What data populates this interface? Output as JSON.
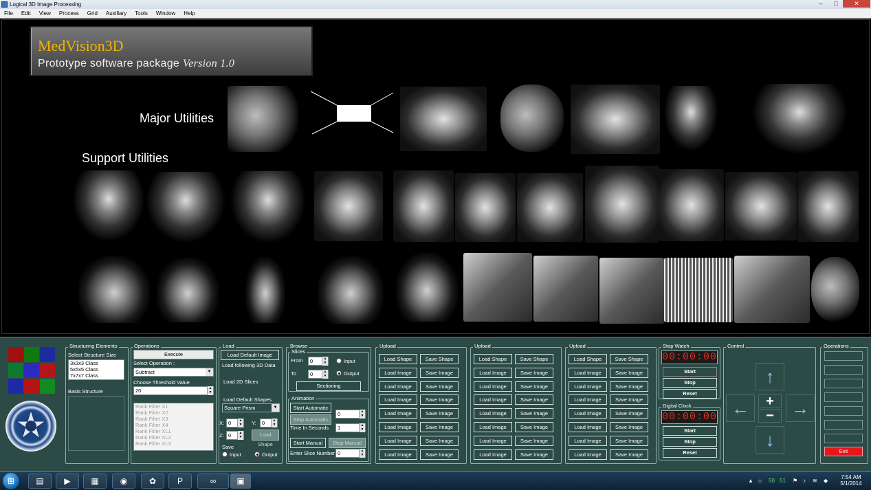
{
  "window": {
    "title": "Logical 3D Image Processing",
    "controls": {
      "minimize": "–",
      "maximize": "□",
      "close": "✕"
    }
  },
  "menu": [
    "File",
    "Edit",
    "View",
    "Process",
    "Grid",
    "Auxillary",
    "Tools",
    "Window",
    "Help"
  ],
  "brand": {
    "title": "MedVision3D",
    "subtitle": "Prototype software package",
    "version": "Version 1.0"
  },
  "headings": {
    "major": "Major Utilities",
    "support": "Support Utilities"
  },
  "structuring": {
    "group_label": "Structuring Elements",
    "size_label": "Select Structure Size",
    "sizes": [
      "3x3x3 Class",
      "5x5x5 Class",
      "7x7x7 Class"
    ],
    "basis_label": "Basis Structure"
  },
  "operations": {
    "group_label": "Operations",
    "execute": "Execute",
    "select_label": "Select Operation :",
    "selected": "Subtract",
    "threshold_label": "Choose Threshold Value",
    "threshold": "20",
    "filters": [
      "Rank Filter X1",
      "Rank Filter X2",
      "Rank Filter X3",
      "Rank Filter X4",
      "Rank Filter XL1",
      "Rank Filter XL2",
      "Rank Filter XL3"
    ]
  },
  "load": {
    "group_label": "Load",
    "default_image": "Load Default Image",
    "following": "Load following 3D Data",
    "slices": "Load 2D Slices",
    "shapes_label": "Load Default Shapes",
    "shape": "Square Prism",
    "x_label": "X:",
    "x_val": "0",
    "y_label": "Y:",
    "y_val": "0",
    "z_label": "Z:",
    "z_val": "0",
    "load_shape": "Load Shape",
    "save_label": "Save",
    "input": "Input",
    "output": "Output"
  },
  "browse": {
    "group_label": "Browse",
    "slices_label": "Slices",
    "from_label": "From",
    "from_val": "0",
    "to_label": "To",
    "to_val": "0",
    "input": "Input",
    "output": "Output",
    "sectioning": "Sectioning",
    "animation_label": "Animation",
    "start_auto": "Start Automatic",
    "stop_auto": "Stop Automatic",
    "auto_val": "0",
    "time_label": "Time In Seconds",
    "time_val": "1",
    "start_manual": "Start Manual",
    "stop_manual": "Stop Manual",
    "slice_label": "Enter Slice Number",
    "slice_val": "0"
  },
  "upload_groups": [
    {
      "label": "Upload",
      "rows": [
        [
          "Load Shape",
          "Save Shape"
        ],
        [
          "Load Image",
          "Save Image"
        ],
        [
          "Load Image",
          "Save Image"
        ],
        [
          "Load Image",
          "Save Image"
        ],
        [
          "Load Image",
          "Save Image"
        ],
        [
          "Load Image",
          "Save Image"
        ],
        [
          "Load Image",
          "Save Image"
        ],
        [
          "Load Image",
          "Save Image"
        ]
      ]
    },
    {
      "label": "Upload",
      "rows": [
        [
          "Load Shape",
          "Save Shape"
        ],
        [
          "Load Image",
          "Save Image"
        ],
        [
          "Load Image",
          "Save Image"
        ],
        [
          "Load Image",
          "Save Image"
        ],
        [
          "Load Image",
          "Save Image"
        ],
        [
          "Load Image",
          "Save Image"
        ],
        [
          "Load Image",
          "Save Image"
        ],
        [
          "Load Image",
          "Save Image"
        ]
      ]
    },
    {
      "label": "Upload",
      "rows": [
        [
          "Load Shape",
          "Save Shape"
        ],
        [
          "Load Image",
          "Save Image"
        ],
        [
          "Load Image",
          "Save Image"
        ],
        [
          "Load Image",
          "Save Image"
        ],
        [
          "Load Image",
          "Save Image"
        ],
        [
          "Load Image",
          "Save Image"
        ],
        [
          "Load Image",
          "Save Image"
        ],
        [
          "Load Image",
          "Save Image"
        ]
      ]
    }
  ],
  "stopwatch": {
    "label": "Stop Watch",
    "display": "00:00:00",
    "start": "Start",
    "stop": "Stop",
    "reset": "Reset"
  },
  "digital_clock": {
    "label": "Digital Clock",
    "display": "00:00:00",
    "start": "Start",
    "stop": "Stop",
    "reset": "Reset"
  },
  "control": {
    "label": "Control",
    "up": "↑",
    "down": "↓",
    "left": "←",
    "right": "→",
    "plus": "+",
    "minus": "−"
  },
  "ops_right": {
    "label": "Operations",
    "exit": "Exit"
  },
  "taskbar": {
    "start": "⊞",
    "tray_time": "7:54 AM",
    "tray_date": "5/1/2014",
    "tray_nums": [
      "50",
      "51"
    ]
  },
  "colors": {
    "panel": "#2c4b47",
    "brand_title": "#f0b400",
    "clock": "#e42b1e",
    "exit": "#e8161b"
  }
}
